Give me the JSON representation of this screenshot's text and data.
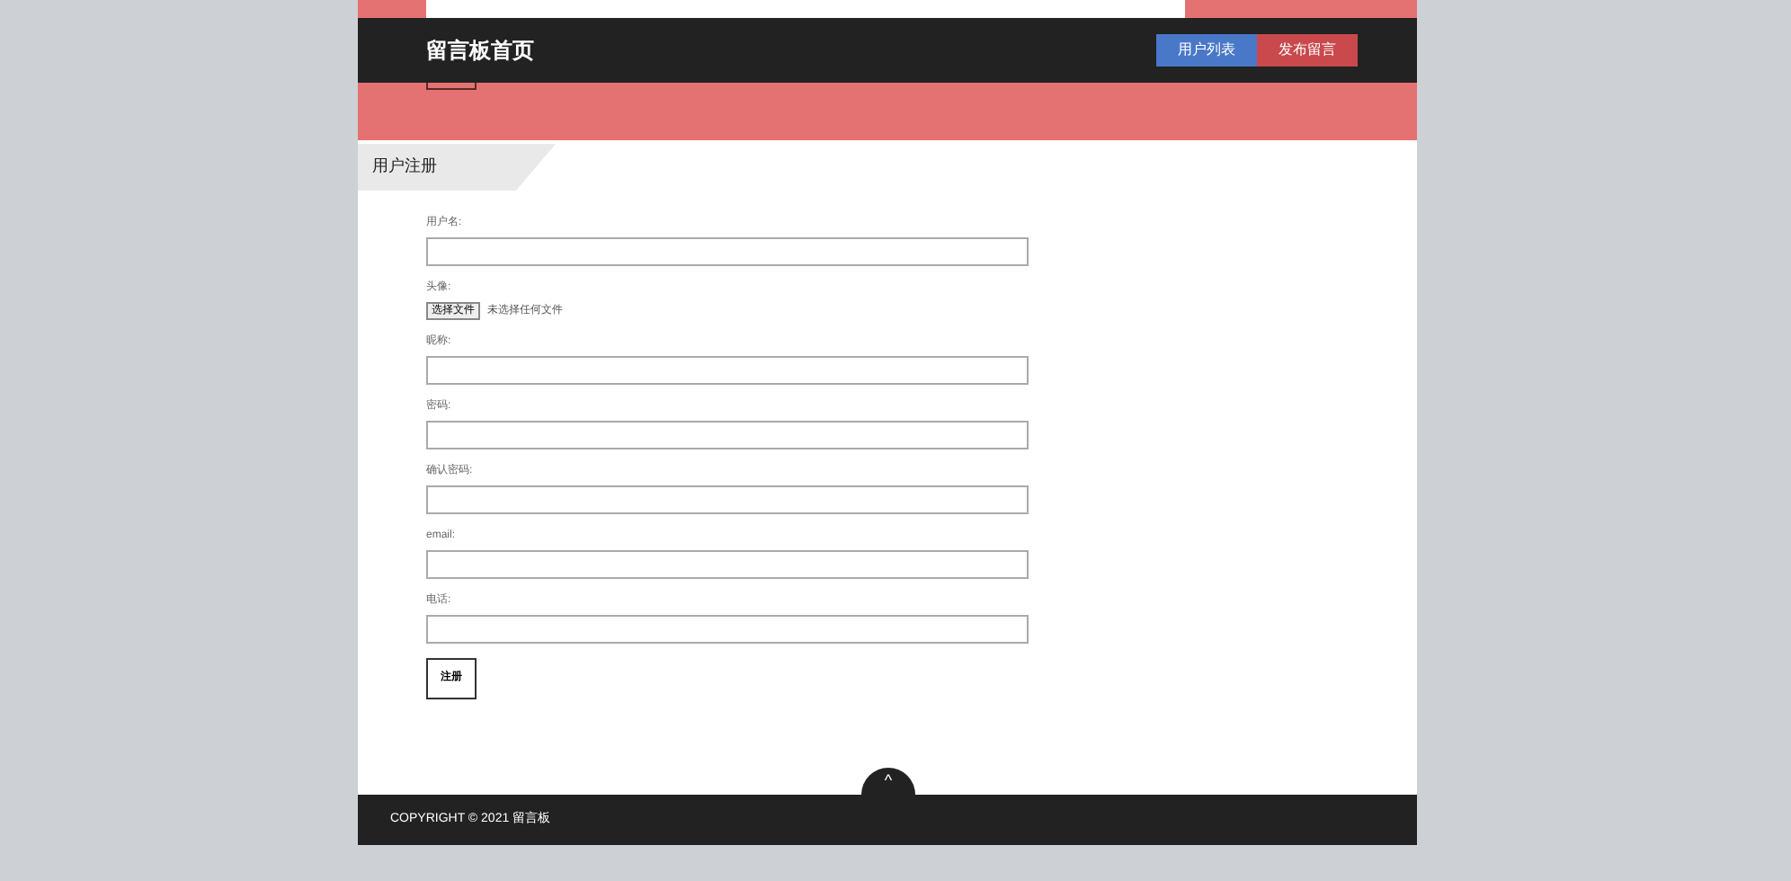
{
  "navbar": {
    "brand": "留言板首页",
    "buttons": [
      {
        "label": "用户列表",
        "kind": "primary"
      },
      {
        "label": "发布留言",
        "kind": "danger"
      }
    ]
  },
  "form": {
    "title": "用户注册",
    "fields": [
      {
        "label": "用户名:",
        "kind": "text"
      },
      {
        "label": "头像:",
        "kind": "file",
        "button": "选择文件",
        "status": "未选择任何文件"
      },
      {
        "label": "昵称:",
        "kind": "text"
      },
      {
        "label": "密码:",
        "kind": "text"
      },
      {
        "label": "确认密码:",
        "kind": "text"
      },
      {
        "label": "email:",
        "kind": "text"
      },
      {
        "label": "电话:",
        "kind": "text"
      }
    ],
    "submit": "注册"
  },
  "footer": {
    "copyright": "COPYRIGHT © 2021 留言板",
    "back_to_top": "^"
  }
}
